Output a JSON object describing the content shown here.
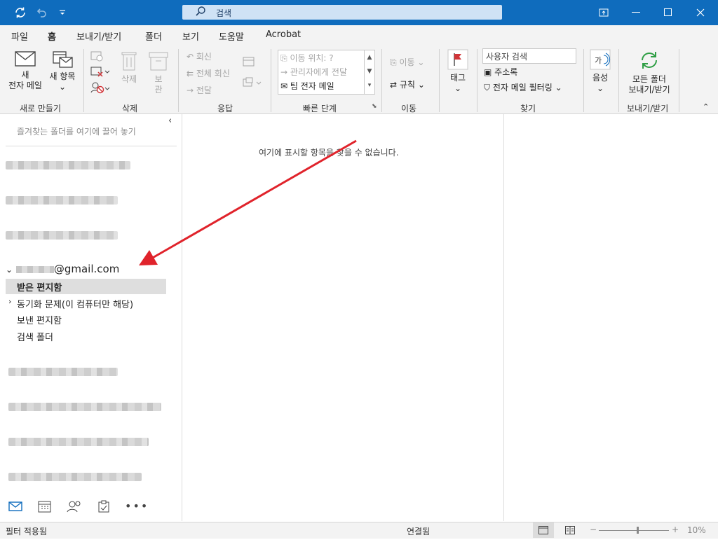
{
  "titlebar": {
    "search_placeholder": "검색"
  },
  "menu": {
    "tabs": [
      "파일",
      "홈",
      "보내기/받기",
      "폴더",
      "보기",
      "도움말",
      "Acrobat"
    ],
    "active": "홈"
  },
  "ribbon": {
    "new_email": [
      "새",
      "전자 메일"
    ],
    "new_items": [
      "새 항목"
    ],
    "delete_label": "삭제",
    "archive": [
      "보",
      "관"
    ],
    "reply": "회신",
    "reply_all": "전체 회신",
    "forward": "전달",
    "quicksteps": {
      "move_to": "이동 위치: ?",
      "to_manager": "관리자에게 전달",
      "team_email": "팀 전자 메일"
    },
    "move": "이동",
    "rules": "규칙",
    "tags": "태그",
    "search_people_placeholder": "사용자 검색",
    "address_book": "주소록",
    "filter_email": "전자 메일 필터링",
    "voice": "음성",
    "send_receive_all": [
      "모든 폴더",
      "보내기/받기"
    ],
    "groups": {
      "new": "새로 만들기",
      "delete": "삭제",
      "respond": "응답",
      "quicksteps": "빠른 단계",
      "move": "이동",
      "find": "찾기",
      "send_receive": "보내기/받기"
    }
  },
  "folderpane": {
    "favorites_hint": "즐겨찾는 폴더를 여기에 끌어 놓기",
    "account": "@gmail.com",
    "folders": [
      "받은 편지함",
      "동기화 문제(이 컴퓨터만 해당)",
      "보낸 편지함",
      "검색 폴더"
    ],
    "selected": "받은 편지함"
  },
  "msglist": {
    "empty_text": "여기에 표시할 항목을 찾을 수 없습니다."
  },
  "statusbar": {
    "left": "필터 적용됨",
    "center": "연결됨",
    "zoom": "10%"
  },
  "colors": {
    "accent": "#0f6cbd",
    "annotation_arrow": "#e0232b"
  }
}
